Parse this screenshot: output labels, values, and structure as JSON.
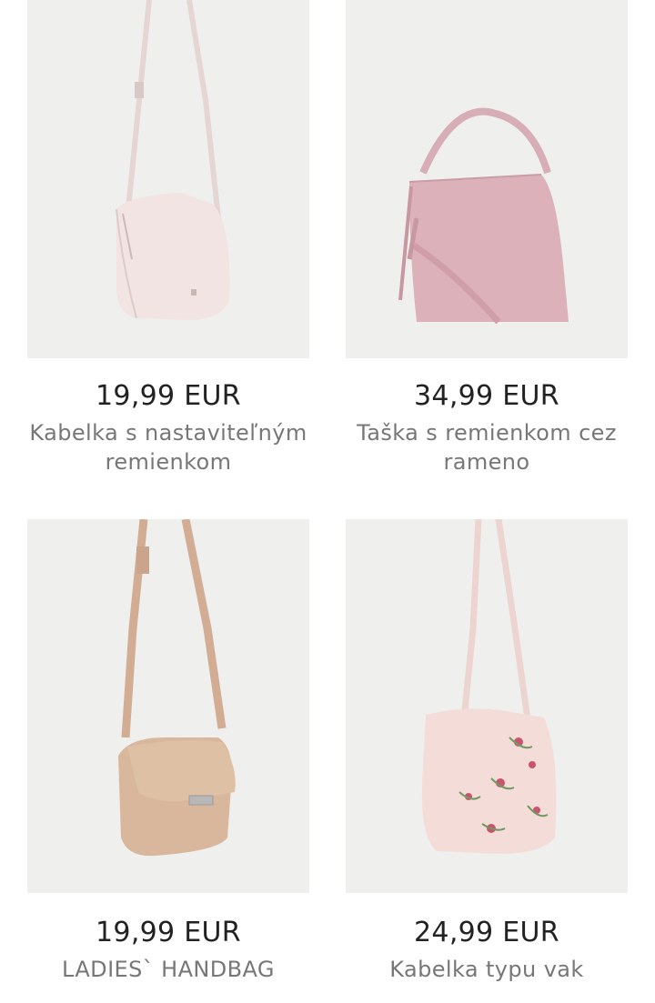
{
  "products": [
    {
      "price": "19,99 EUR",
      "name": "Kabelka s nastaviteľným remienkom",
      "image": "light-pink-crossbody-bag"
    },
    {
      "price": "34,99 EUR",
      "name": "Taška s remienkom cez rameno",
      "image": "pink-hobo-bag"
    },
    {
      "price": "19,99 EUR",
      "name": "LADIES` HANDBAG",
      "image": "beige-flap-crossbody-bag"
    },
    {
      "price": "24,99 EUR",
      "name": "Kabelka typu vak",
      "image": "embroidered-bucket-bag"
    }
  ]
}
